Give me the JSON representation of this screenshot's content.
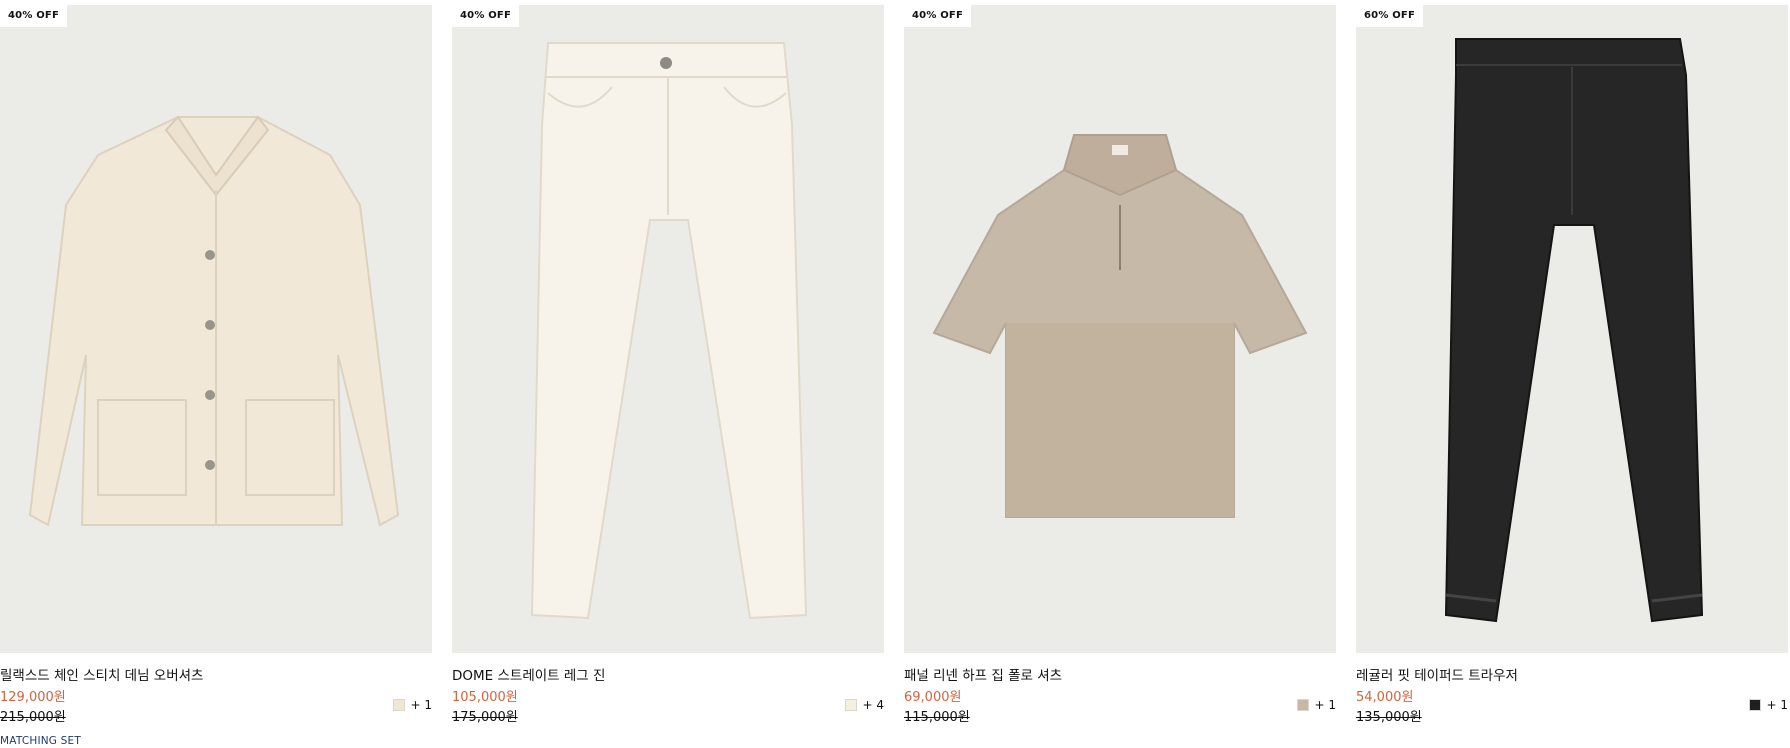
{
  "products": [
    {
      "badge": "40% OFF",
      "title": "릴랙스드 체인 스티치 데님 오버셔츠",
      "sale_price": "129,000원",
      "original_price": "215,000원",
      "swatch_color": "#efe6d4",
      "more_colors": "+ 1",
      "tag": "MATCHING SET",
      "image_icon": "overshirt-icon"
    },
    {
      "badge": "40% OFF",
      "title": "DOME 스트레이트 레그 진",
      "sale_price": "105,000원",
      "original_price": "175,000원",
      "swatch_color": "#f3efe1",
      "more_colors": "+ 4",
      "image_icon": "jeans-icon"
    },
    {
      "badge": "40% OFF",
      "title": "패널 리넨 하프 집 폴로 셔츠",
      "sale_price": "69,000원",
      "original_price": "115,000원",
      "swatch_color": "#c8b8a6",
      "more_colors": "+ 1",
      "image_icon": "polo-shirt-icon"
    },
    {
      "badge": "60% OFF",
      "title": "레귤러 핏 테이퍼드 트라우저",
      "sale_price": "54,000원",
      "original_price": "135,000원",
      "swatch_color": "#1f1f1f",
      "more_colors": "+ 1",
      "image_icon": "trousers-icon"
    }
  ],
  "colors": {
    "sale_price": "#d3633c",
    "tag": "#1f3a73",
    "image_bg": "#ebebe8"
  }
}
